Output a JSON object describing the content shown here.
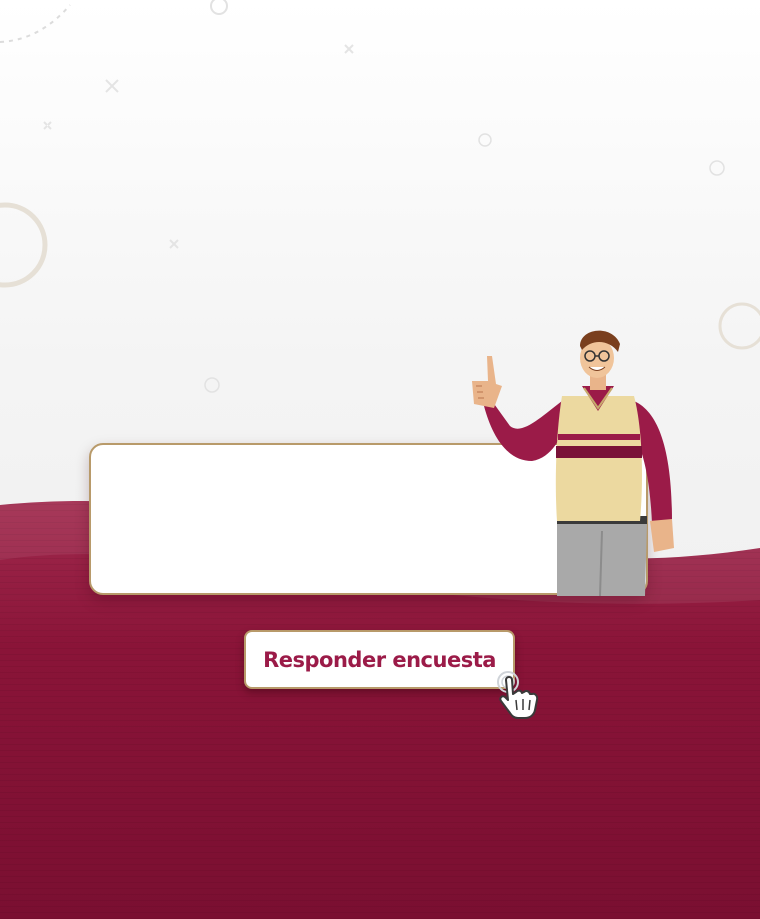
{
  "survey_button": {
    "label": "Responder encuesta"
  },
  "colors": {
    "brand_wine": "#8a1438",
    "brand_wine_dark": "#6b0e2c",
    "accent_gold": "#b89a6a",
    "button_text": "#9b1b48"
  },
  "icons": [
    "pointing-hand-cursor-icon",
    "man-pointing-illustration"
  ]
}
